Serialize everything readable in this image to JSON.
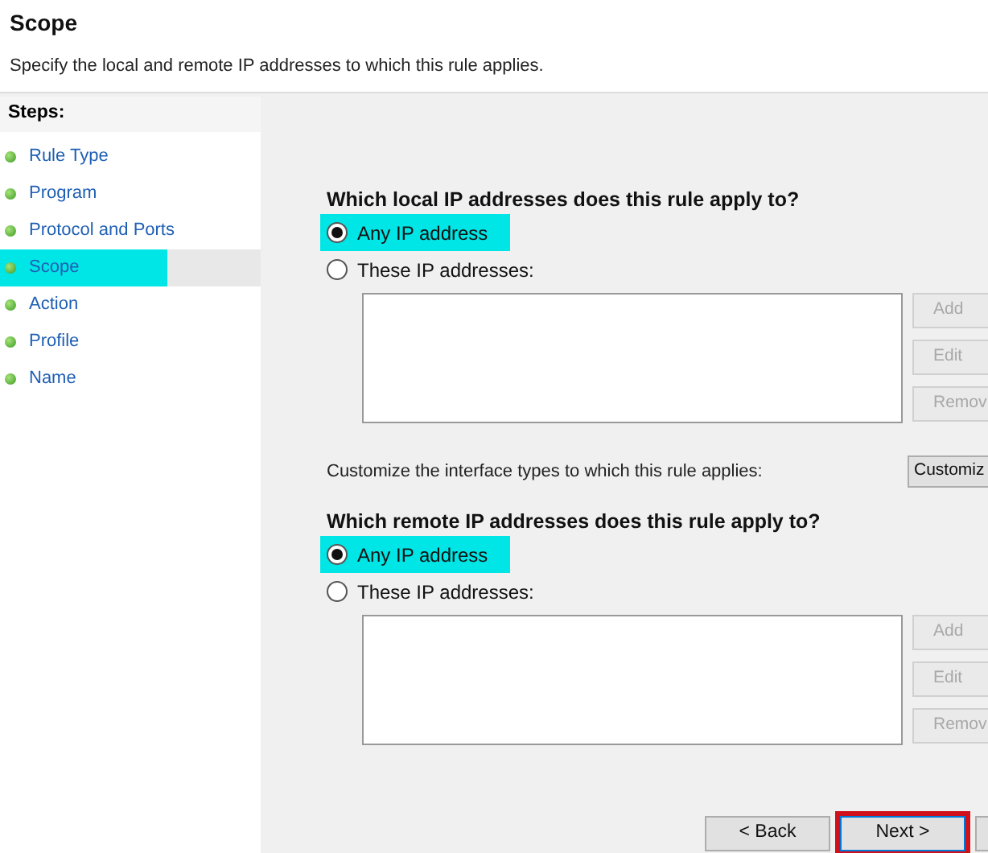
{
  "header": {
    "title": "Scope",
    "subtitle": "Specify the local and remote IP addresses to which this rule applies."
  },
  "steps": {
    "heading": "Steps:",
    "items": [
      {
        "label": "Rule Type",
        "selected": false,
        "highlighted": false
      },
      {
        "label": "Program",
        "selected": false,
        "highlighted": false
      },
      {
        "label": "Protocol and Ports",
        "selected": false,
        "highlighted": false
      },
      {
        "label": "Scope",
        "selected": true,
        "highlighted": true
      },
      {
        "label": "Action",
        "selected": false,
        "highlighted": false
      },
      {
        "label": "Profile",
        "selected": false,
        "highlighted": false
      },
      {
        "label": "Name",
        "selected": false,
        "highlighted": false
      }
    ]
  },
  "sections": [
    {
      "question": "Which local IP addresses does this rule apply to?",
      "options": [
        {
          "label": "Any IP address",
          "selected": true,
          "highlighted": true
        },
        {
          "label": "These IP addresses:",
          "selected": false,
          "highlighted": false
        }
      ],
      "buttons": [
        {
          "label": "Add",
          "disabled": true
        },
        {
          "label": "Edit",
          "disabled": true
        },
        {
          "label": "Remov",
          "disabled": true
        }
      ],
      "customize": {
        "text": "Customize the interface types to which this rule applies:",
        "button": "Customiz"
      }
    },
    {
      "question": "Which remote IP addresses does this rule apply to?",
      "options": [
        {
          "label": "Any IP address",
          "selected": true,
          "highlighted": true
        },
        {
          "label": "These IP addresses:",
          "selected": false,
          "highlighted": false
        }
      ],
      "buttons": [
        {
          "label": "Add",
          "disabled": true
        },
        {
          "label": "Edit",
          "disabled": true
        },
        {
          "label": "Remov",
          "disabled": true
        }
      ]
    }
  ],
  "footer": {
    "buttons": [
      {
        "label": "< Back",
        "outlined": false
      },
      {
        "label": "Next >",
        "outlined": true
      }
    ]
  }
}
